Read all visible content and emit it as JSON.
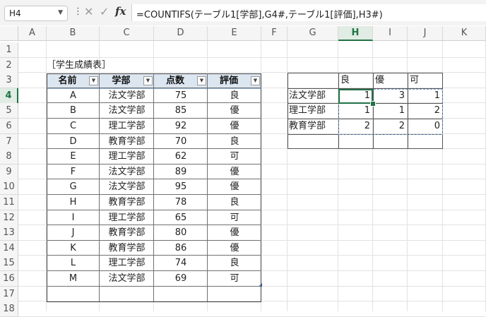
{
  "formula_bar": {
    "name_box": "H4",
    "formula": "=COUNTIFS(テーブル1[学部],G4#,テーブル1[評価],H3#)"
  },
  "icons": {
    "more": "more-vertical-icon",
    "cancel": "cancel-x-icon",
    "enter": "check-icon",
    "function": "fx-icon"
  },
  "columns": [
    "A",
    "B",
    "C",
    "D",
    "E",
    "F",
    "G",
    "H",
    "I",
    "J",
    "K"
  ],
  "rows": [
    "1",
    "2",
    "3",
    "4",
    "5",
    "6",
    "7",
    "8",
    "9",
    "10",
    "11",
    "12",
    "13",
    "14",
    "15",
    "16",
    "17",
    "18"
  ],
  "active_cell": {
    "column": "H",
    "row": "4"
  },
  "sheet_title": "［学生成績表］",
  "student_table": {
    "headers": [
      "名前",
      "学部",
      "点数",
      "評価"
    ],
    "rows": [
      [
        "A",
        "法文学部",
        "75",
        "良"
      ],
      [
        "B",
        "法文学部",
        "85",
        "優"
      ],
      [
        "C",
        "理工学部",
        "92",
        "優"
      ],
      [
        "D",
        "教育学部",
        "70",
        "良"
      ],
      [
        "E",
        "理工学部",
        "62",
        "可"
      ],
      [
        "F",
        "法文学部",
        "89",
        "優"
      ],
      [
        "G",
        "法文学部",
        "95",
        "優"
      ],
      [
        "H",
        "教育学部",
        "78",
        "良"
      ],
      [
        "I",
        "理工学部",
        "65",
        "可"
      ],
      [
        "J",
        "教育学部",
        "80",
        "優"
      ],
      [
        "K",
        "教育学部",
        "86",
        "優"
      ],
      [
        "L",
        "理工学部",
        "74",
        "良"
      ],
      [
        "M",
        "法文学部",
        "69",
        "可"
      ]
    ]
  },
  "summary": {
    "col_headers": [
      "良",
      "優",
      "可"
    ],
    "rows": [
      {
        "label": "法文学部",
        "values": [
          "1",
          "3",
          "1"
        ]
      },
      {
        "label": "理工学部",
        "values": [
          "1",
          "1",
          "2"
        ]
      },
      {
        "label": "教育学部",
        "values": [
          "2",
          "2",
          "0"
        ]
      }
    ]
  },
  "colors": {
    "accent": "#217346",
    "table_header": "#dce6f1"
  }
}
